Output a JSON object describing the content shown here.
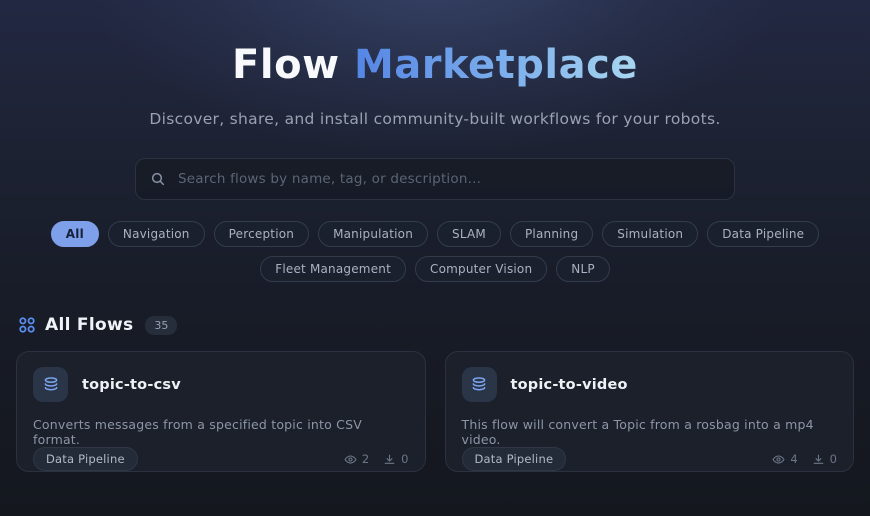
{
  "hero": {
    "title_primary": "Flow",
    "title_accent": "Marketplace",
    "subtitle": "Discover, share, and install community-built workflows for your robots."
  },
  "search": {
    "placeholder": "Search flows by name, tag, or description..."
  },
  "filters": [
    {
      "label": "All",
      "active": true
    },
    {
      "label": "Navigation",
      "active": false
    },
    {
      "label": "Perception",
      "active": false
    },
    {
      "label": "Manipulation",
      "active": false
    },
    {
      "label": "SLAM",
      "active": false
    },
    {
      "label": "Planning",
      "active": false
    },
    {
      "label": "Simulation",
      "active": false
    },
    {
      "label": "Data Pipeline",
      "active": false
    },
    {
      "label": "Fleet Management",
      "active": false
    },
    {
      "label": "Computer Vision",
      "active": false
    },
    {
      "label": "NLP",
      "active": false
    }
  ],
  "section": {
    "title": "All Flows",
    "count": "35"
  },
  "flows": [
    {
      "name": "topic-to-csv",
      "description": "Converts messages from a specified topic into CSV format.",
      "tag": "Data Pipeline",
      "views": "2",
      "downloads": "0"
    },
    {
      "name": "topic-to-video",
      "description": "This flow will convert a Topic from a rosbag into a mp4 video.",
      "tag": "Data Pipeline",
      "views": "4",
      "downloads": "0"
    }
  ],
  "icons": {
    "search": "magnifier",
    "section": "grid-of-circles",
    "flow": "database-stack",
    "views": "eye",
    "downloads": "download-arrow"
  },
  "colors": {
    "accent_pill": "#7e9fe9",
    "title_gradient_start": "#5585e5",
    "title_gradient_end": "#a9d6f0",
    "card_bg": "#1b202b",
    "icon_blue": "#7aa4ee"
  }
}
